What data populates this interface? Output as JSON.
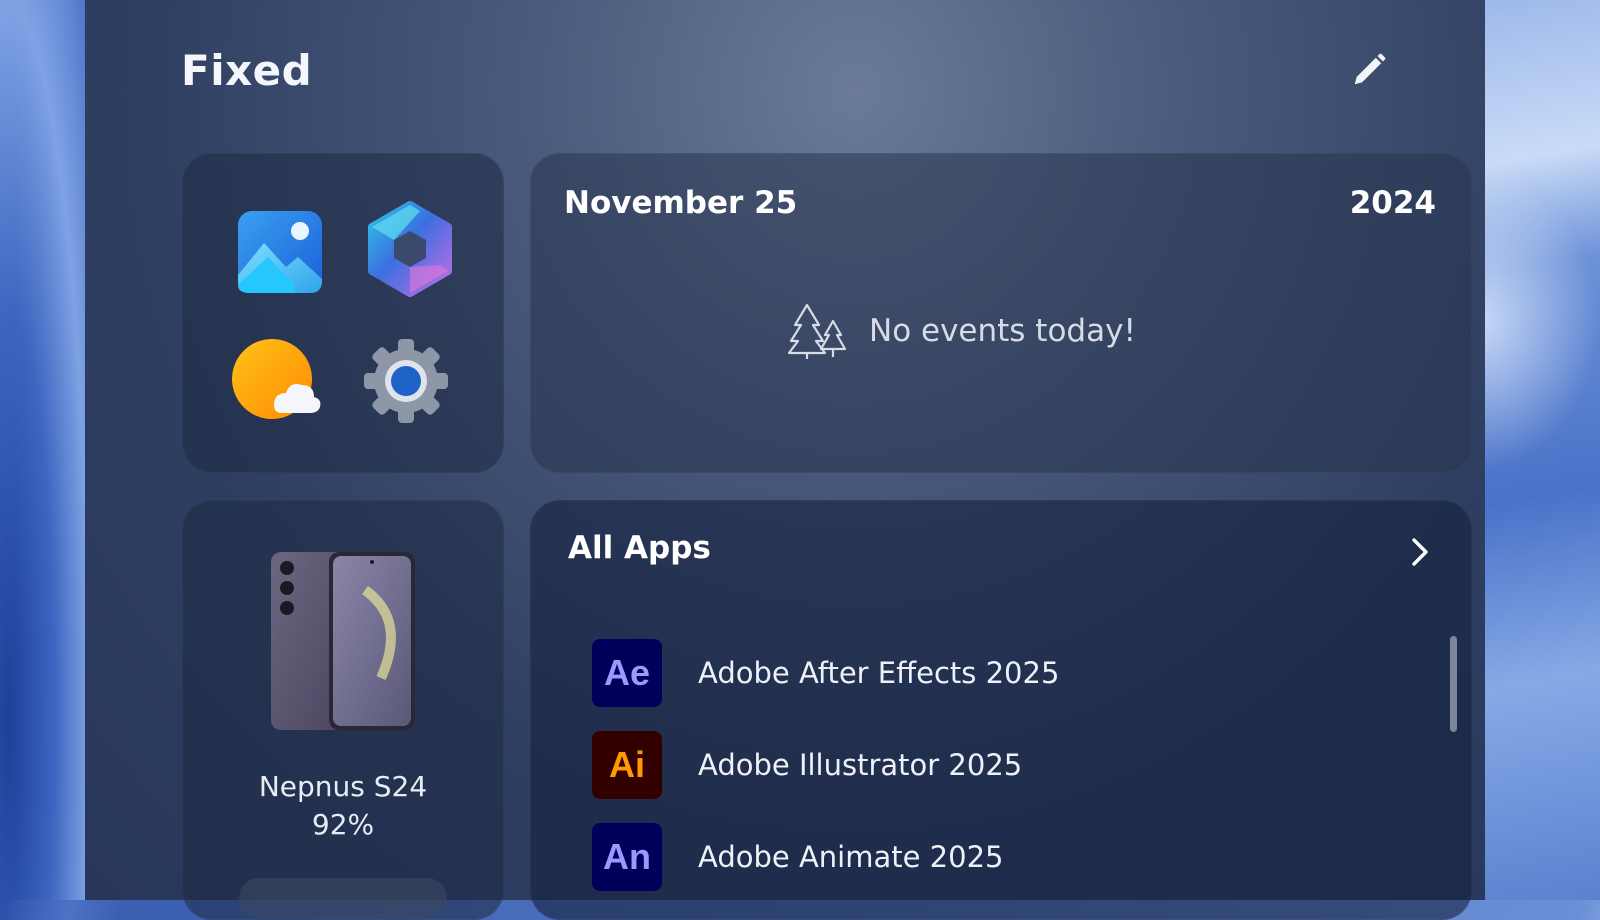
{
  "header": {
    "title": "Fixed",
    "edit_icon": "pencil-icon"
  },
  "pinned_apps": [
    {
      "name": "Photos",
      "icon": "photos-icon"
    },
    {
      "name": "Microsoft 365 Copilot",
      "icon": "copilot-icon"
    },
    {
      "name": "Weather",
      "icon": "weather-icon"
    },
    {
      "name": "Settings",
      "icon": "settings-icon"
    }
  ],
  "calendar": {
    "date": "November 25",
    "year": "2024",
    "empty_message": "No events today!",
    "empty_icon": "trees-icon"
  },
  "device": {
    "name": "Nepnus S24",
    "battery": "92%"
  },
  "all_apps": {
    "title": "All Apps",
    "items": [
      {
        "badge": "Ae",
        "label": "Adobe After Effects 2025",
        "badge_bg": "#00005b",
        "badge_fg": "#9999ff"
      },
      {
        "badge": "Ai",
        "label": "Adobe Illustrator 2025",
        "badge_bg": "#330000",
        "badge_fg": "#ff9a00"
      },
      {
        "badge": "An",
        "label": "Adobe Animate 2025",
        "badge_bg": "#00005b",
        "badge_fg": "#9999ff"
      }
    ]
  }
}
